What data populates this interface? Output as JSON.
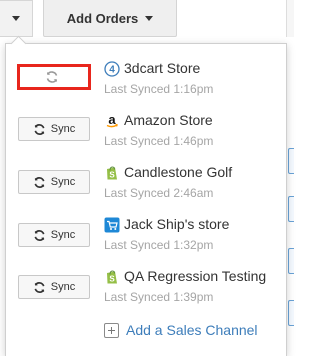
{
  "toolbar": {
    "add_orders_label": "Add Orders"
  },
  "stores": [
    {
      "name": "3dcart Store",
      "last_synced": "Last Synced 1:16pm",
      "icon": "3dcart-icon",
      "sync_label": "",
      "syncing": true
    },
    {
      "name": "Amazon Store",
      "last_synced": "Last Synced 1:46pm",
      "icon": "amazon-icon",
      "sync_label": "Sync",
      "syncing": false
    },
    {
      "name": "Candlestone Golf",
      "last_synced": "Last Synced 2:46am",
      "icon": "shopify-icon",
      "sync_label": "Sync",
      "syncing": false
    },
    {
      "name": "Jack Ship's store",
      "last_synced": "Last Synced 1:32pm",
      "icon": "shipping-cart-icon",
      "sync_label": "Sync",
      "syncing": false
    },
    {
      "name": "QA Regression Testing",
      "last_synced": "Last Synced 1:39pm",
      "icon": "shopify-icon",
      "sync_label": "Sync",
      "syncing": false
    }
  ],
  "add_channel": {
    "label": "Add a Sales Channel"
  },
  "colors": {
    "link": "#3d7dba",
    "highlight": "#e8261d",
    "muted": "#a5a5a5",
    "shopify": "#95bf47",
    "cart": "#1e88d6"
  }
}
